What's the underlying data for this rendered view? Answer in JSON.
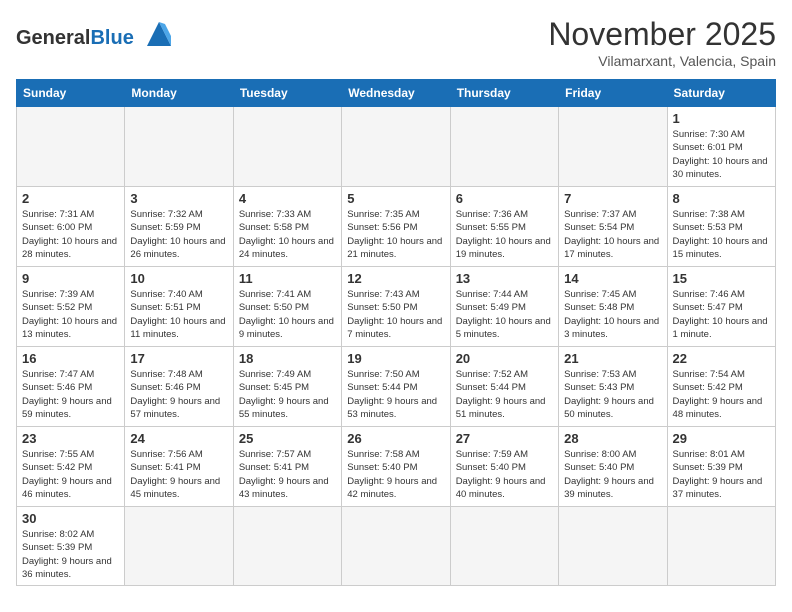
{
  "header": {
    "logo_general": "General",
    "logo_blue": "Blue",
    "title": "November 2025",
    "subtitle": "Vilamarxant, Valencia, Spain"
  },
  "weekdays": [
    "Sunday",
    "Monday",
    "Tuesday",
    "Wednesday",
    "Thursday",
    "Friday",
    "Saturday"
  ],
  "weeks": [
    [
      {
        "day": "",
        "info": ""
      },
      {
        "day": "",
        "info": ""
      },
      {
        "day": "",
        "info": ""
      },
      {
        "day": "",
        "info": ""
      },
      {
        "day": "",
        "info": ""
      },
      {
        "day": "",
        "info": ""
      },
      {
        "day": "1",
        "info": "Sunrise: 7:30 AM\nSunset: 6:01 PM\nDaylight: 10 hours and 30 minutes."
      }
    ],
    [
      {
        "day": "2",
        "info": "Sunrise: 7:31 AM\nSunset: 6:00 PM\nDaylight: 10 hours and 28 minutes."
      },
      {
        "day": "3",
        "info": "Sunrise: 7:32 AM\nSunset: 5:59 PM\nDaylight: 10 hours and 26 minutes."
      },
      {
        "day": "4",
        "info": "Sunrise: 7:33 AM\nSunset: 5:58 PM\nDaylight: 10 hours and 24 minutes."
      },
      {
        "day": "5",
        "info": "Sunrise: 7:35 AM\nSunset: 5:56 PM\nDaylight: 10 hours and 21 minutes."
      },
      {
        "day": "6",
        "info": "Sunrise: 7:36 AM\nSunset: 5:55 PM\nDaylight: 10 hours and 19 minutes."
      },
      {
        "day": "7",
        "info": "Sunrise: 7:37 AM\nSunset: 5:54 PM\nDaylight: 10 hours and 17 minutes."
      },
      {
        "day": "8",
        "info": "Sunrise: 7:38 AM\nSunset: 5:53 PM\nDaylight: 10 hours and 15 minutes."
      }
    ],
    [
      {
        "day": "9",
        "info": "Sunrise: 7:39 AM\nSunset: 5:52 PM\nDaylight: 10 hours and 13 minutes."
      },
      {
        "day": "10",
        "info": "Sunrise: 7:40 AM\nSunset: 5:51 PM\nDaylight: 10 hours and 11 minutes."
      },
      {
        "day": "11",
        "info": "Sunrise: 7:41 AM\nSunset: 5:50 PM\nDaylight: 10 hours and 9 minutes."
      },
      {
        "day": "12",
        "info": "Sunrise: 7:43 AM\nSunset: 5:50 PM\nDaylight: 10 hours and 7 minutes."
      },
      {
        "day": "13",
        "info": "Sunrise: 7:44 AM\nSunset: 5:49 PM\nDaylight: 10 hours and 5 minutes."
      },
      {
        "day": "14",
        "info": "Sunrise: 7:45 AM\nSunset: 5:48 PM\nDaylight: 10 hours and 3 minutes."
      },
      {
        "day": "15",
        "info": "Sunrise: 7:46 AM\nSunset: 5:47 PM\nDaylight: 10 hours and 1 minute."
      }
    ],
    [
      {
        "day": "16",
        "info": "Sunrise: 7:47 AM\nSunset: 5:46 PM\nDaylight: 9 hours and 59 minutes."
      },
      {
        "day": "17",
        "info": "Sunrise: 7:48 AM\nSunset: 5:46 PM\nDaylight: 9 hours and 57 minutes."
      },
      {
        "day": "18",
        "info": "Sunrise: 7:49 AM\nSunset: 5:45 PM\nDaylight: 9 hours and 55 minutes."
      },
      {
        "day": "19",
        "info": "Sunrise: 7:50 AM\nSunset: 5:44 PM\nDaylight: 9 hours and 53 minutes."
      },
      {
        "day": "20",
        "info": "Sunrise: 7:52 AM\nSunset: 5:44 PM\nDaylight: 9 hours and 51 minutes."
      },
      {
        "day": "21",
        "info": "Sunrise: 7:53 AM\nSunset: 5:43 PM\nDaylight: 9 hours and 50 minutes."
      },
      {
        "day": "22",
        "info": "Sunrise: 7:54 AM\nSunset: 5:42 PM\nDaylight: 9 hours and 48 minutes."
      }
    ],
    [
      {
        "day": "23",
        "info": "Sunrise: 7:55 AM\nSunset: 5:42 PM\nDaylight: 9 hours and 46 minutes."
      },
      {
        "day": "24",
        "info": "Sunrise: 7:56 AM\nSunset: 5:41 PM\nDaylight: 9 hours and 45 minutes."
      },
      {
        "day": "25",
        "info": "Sunrise: 7:57 AM\nSunset: 5:41 PM\nDaylight: 9 hours and 43 minutes."
      },
      {
        "day": "26",
        "info": "Sunrise: 7:58 AM\nSunset: 5:40 PM\nDaylight: 9 hours and 42 minutes."
      },
      {
        "day": "27",
        "info": "Sunrise: 7:59 AM\nSunset: 5:40 PM\nDaylight: 9 hours and 40 minutes."
      },
      {
        "day": "28",
        "info": "Sunrise: 8:00 AM\nSunset: 5:40 PM\nDaylight: 9 hours and 39 minutes."
      },
      {
        "day": "29",
        "info": "Sunrise: 8:01 AM\nSunset: 5:39 PM\nDaylight: 9 hours and 37 minutes."
      }
    ],
    [
      {
        "day": "30",
        "info": "Sunrise: 8:02 AM\nSunset: 5:39 PM\nDaylight: 9 hours and 36 minutes."
      },
      {
        "day": "",
        "info": ""
      },
      {
        "day": "",
        "info": ""
      },
      {
        "day": "",
        "info": ""
      },
      {
        "day": "",
        "info": ""
      },
      {
        "day": "",
        "info": ""
      },
      {
        "day": "",
        "info": ""
      }
    ]
  ]
}
